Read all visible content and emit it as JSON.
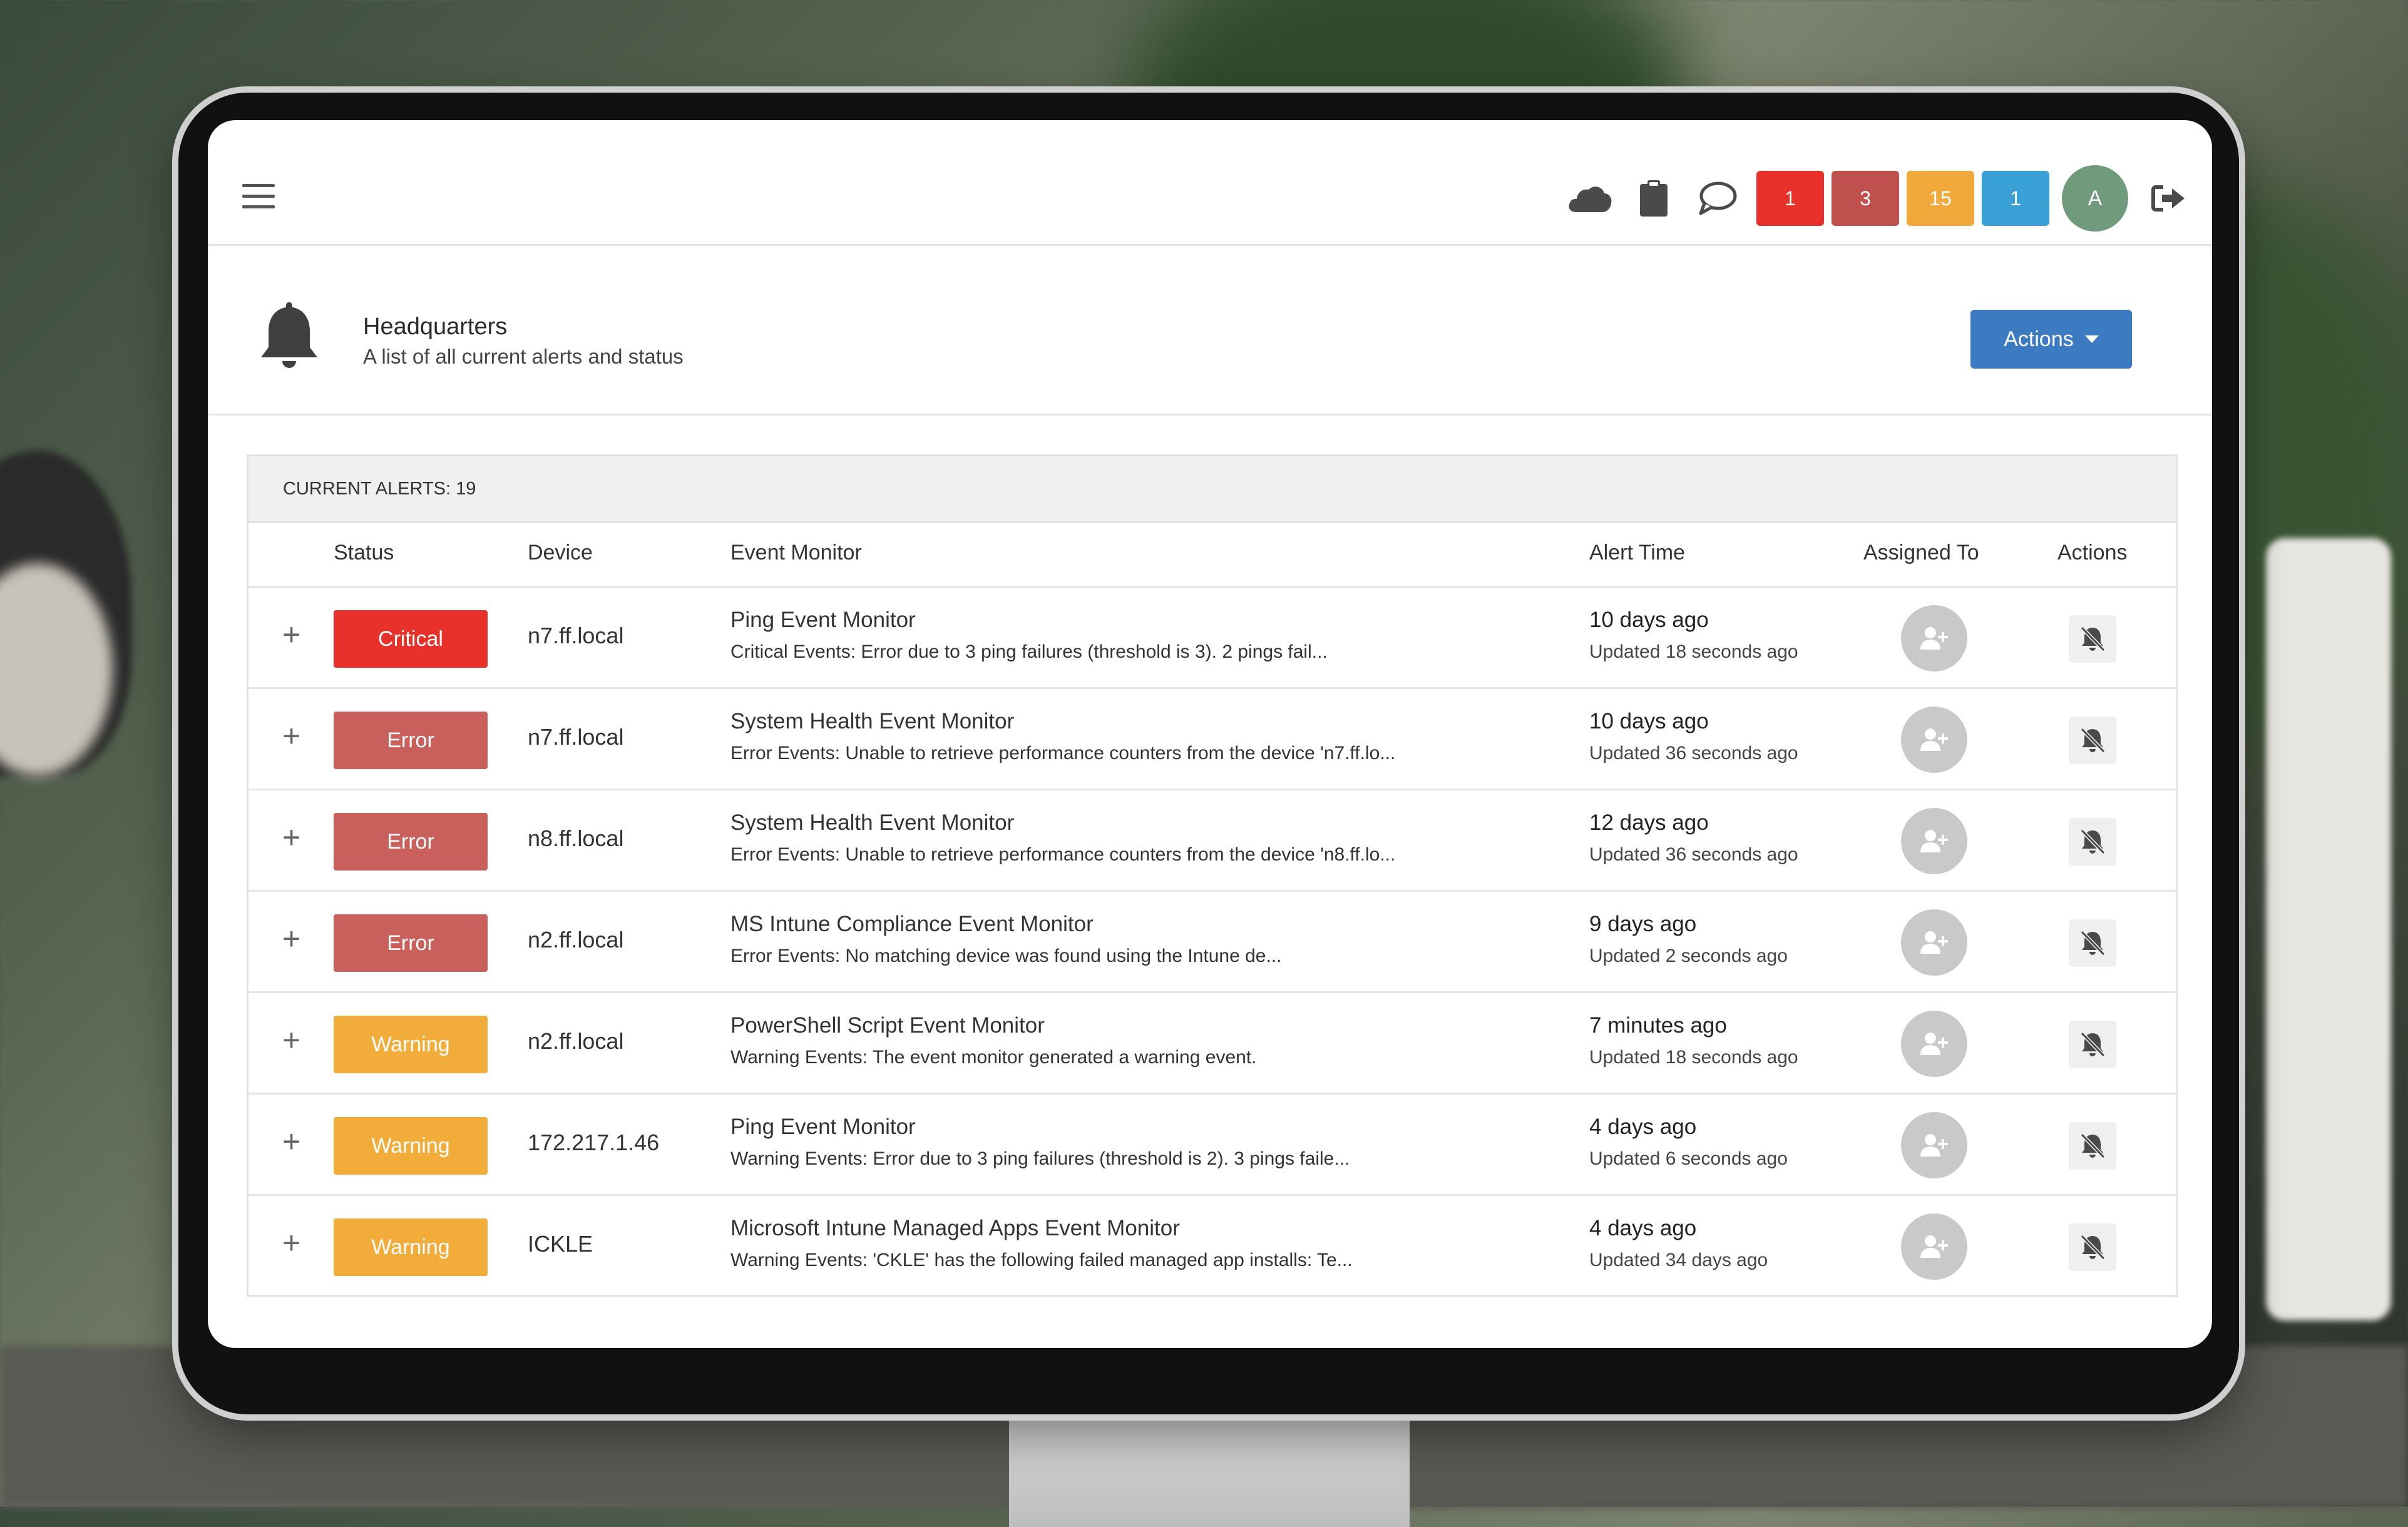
{
  "topbar": {
    "badges": [
      {
        "label": "1",
        "color": "#e8312a"
      },
      {
        "label": "3",
        "color": "#c0504d"
      },
      {
        "label": "15",
        "color": "#f2a93b"
      },
      {
        "label": "1",
        "color": "#39a1d6"
      }
    ],
    "avatar_initial": "A",
    "icons": [
      "cloud-icon",
      "clipboard-icon",
      "chat-icon",
      "logout-icon"
    ]
  },
  "header": {
    "title": "Headquarters",
    "subtitle": "A list of all current alerts and status",
    "actions_label": "Actions"
  },
  "panel": {
    "title": "CURRENT ALERTS: 19",
    "columns": {
      "status": "Status",
      "device": "Device",
      "event_monitor": "Event Monitor",
      "alert_time": "Alert Time",
      "assigned_to": "Assigned To",
      "actions": "Actions"
    },
    "rows": [
      {
        "status": "Critical",
        "status_color": "#e8312a",
        "device": "n7.ff.local",
        "monitor": "Ping Event Monitor",
        "description": "Critical Events: Error due to 3 ping failures (threshold is 3). 2 pings fail...",
        "alert_time": "10 days ago",
        "updated": "Updated 18 seconds ago"
      },
      {
        "status": "Error",
        "status_color": "#c9605c",
        "device": "n7.ff.local",
        "monitor": "System Health Event Monitor",
        "description": "Error Events: Unable to retrieve performance counters from the device 'n7.ff.lo...",
        "alert_time": "10 days ago",
        "updated": "Updated 36 seconds ago"
      },
      {
        "status": "Error",
        "status_color": "#c9605c",
        "device": "n8.ff.local",
        "monitor": "System Health Event Monitor",
        "description": "Error Events: Unable to retrieve performance counters from the device 'n8.ff.lo...",
        "alert_time": "12 days ago",
        "updated": "Updated 36 seconds ago"
      },
      {
        "status": "Error",
        "status_color": "#c9605c",
        "device": "n2.ff.local",
        "monitor": "MS Intune Compliance Event Monitor",
        "description": "Error Events: No matching device was found using the Intune de...",
        "alert_time": "9 days ago",
        "updated": "Updated 2 seconds ago"
      },
      {
        "status": "Warning",
        "status_color": "#f2ac3a",
        "device": "n2.ff.local",
        "monitor": "PowerShell Script Event Monitor",
        "description": "Warning Events: The event monitor generated a warning event.",
        "alert_time": "7 minutes ago",
        "updated": "Updated 18 seconds ago"
      },
      {
        "status": "Warning",
        "status_color": "#f2ac3a",
        "device": "172.217.1.46",
        "monitor": "Ping Event Monitor",
        "description": "Warning Events: Error due to 3 ping failures (threshold is 2). 3 pings faile...",
        "alert_time": "4 days ago",
        "updated": "Updated 6 seconds ago"
      },
      {
        "status": "Warning",
        "status_color": "#f2ac3a",
        "device": "ICKLE",
        "monitor": "Microsoft Intune Managed Apps Event Monitor",
        "description": "Warning Events: 'CKLE' has the following failed managed app installs: Te...",
        "alert_time": "4 days ago",
        "updated": "Updated 34 days ago"
      }
    ]
  }
}
